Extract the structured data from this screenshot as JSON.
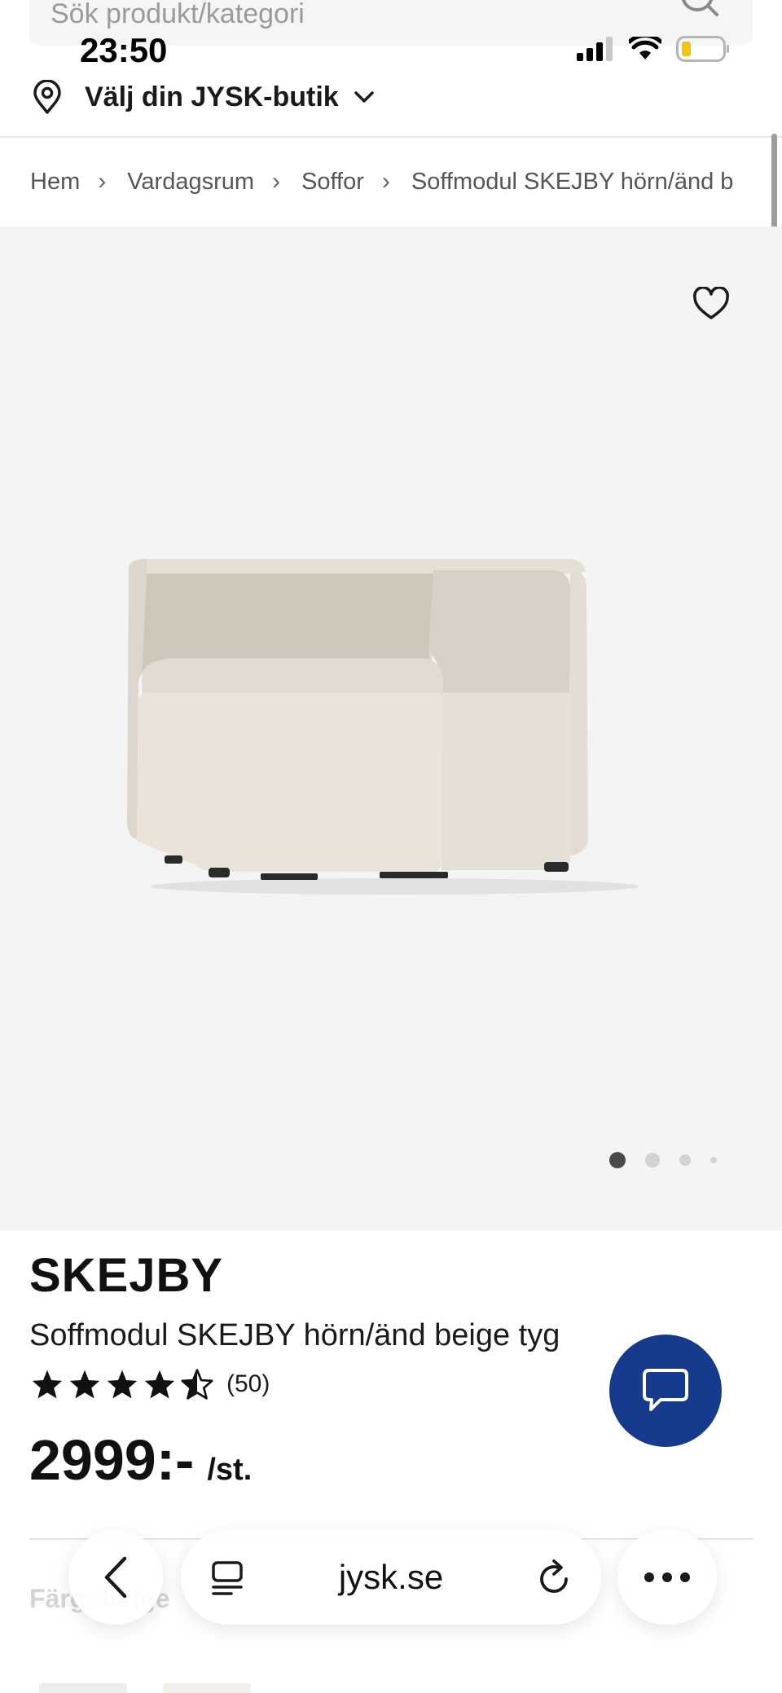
{
  "search": {
    "placeholder": "Sök produkt/kategori"
  },
  "status_bar": {
    "time": "23:50"
  },
  "store": {
    "label": "Välj din JYSK-butik"
  },
  "breadcrumb": [
    "Hem",
    "Vardagsrum",
    "Soffor",
    "Soffmodul SKEJBY hörn/änd b"
  ],
  "gallery": {
    "image_count": 4,
    "active_index": 0
  },
  "product": {
    "brand": "SKEJBY",
    "name": "Soffmodul SKEJBY hörn/änd beige tyg",
    "rating": 4.5,
    "rating_count": "(50)",
    "price": "2999:-",
    "price_unit": "/st.",
    "color_label": "Färg: beige"
  },
  "browser": {
    "url": "jysk.se"
  },
  "colors": {
    "accent": "#163b8c",
    "background": "#f4f4f4",
    "text": "#1a1a1a"
  }
}
